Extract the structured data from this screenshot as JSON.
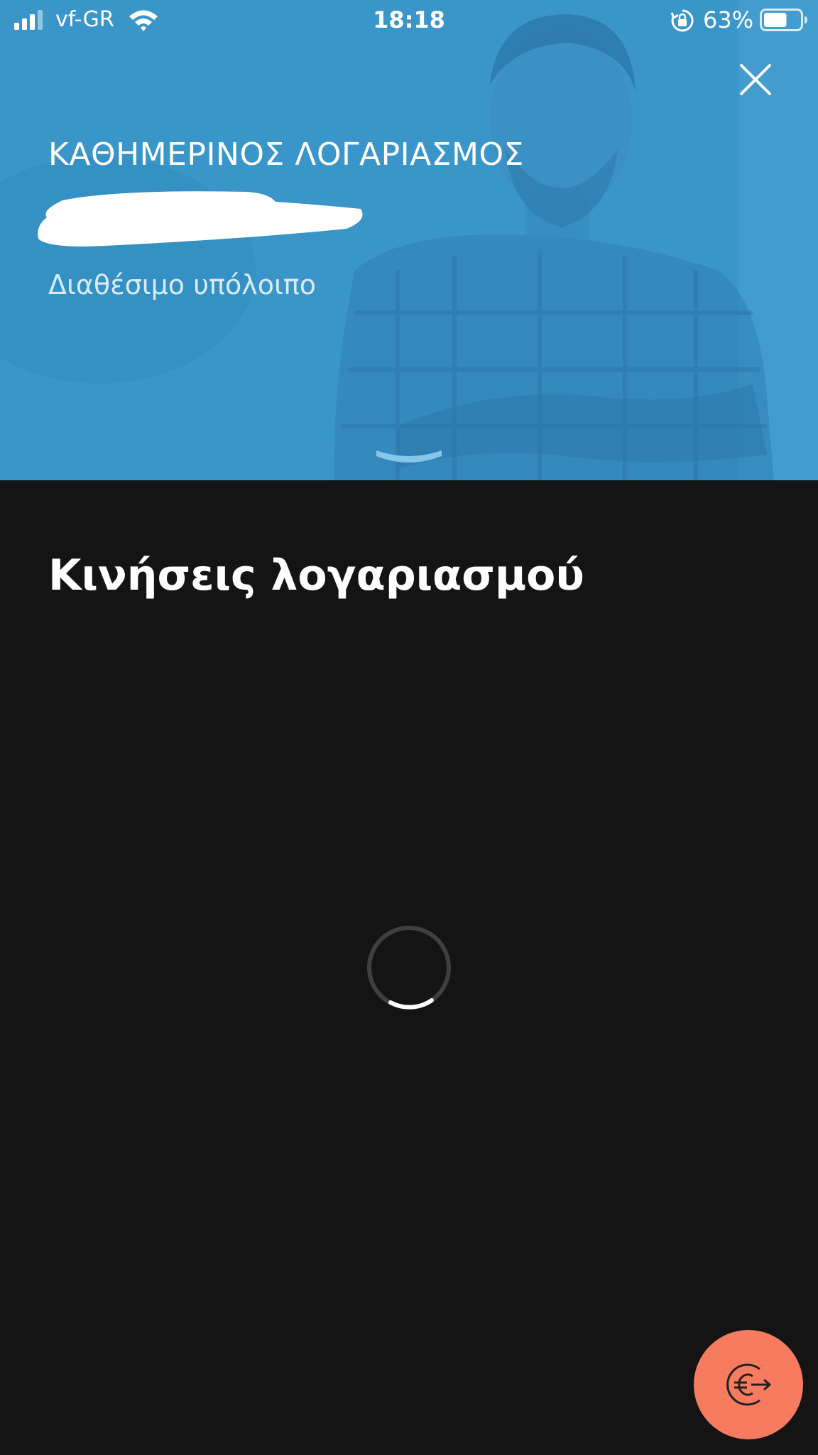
{
  "status_bar": {
    "carrier": "vf-GR",
    "time": "18:18",
    "battery_percent": "63%",
    "battery_level": 0.63,
    "icons": [
      "signal-icon",
      "wifi-icon",
      "rotation-lock-icon",
      "battery-icon"
    ]
  },
  "header": {
    "account_name": "ΚΑΘΗΜΕΡΙΝΟΣ ΛΟΓΑΡΙΑΣΜΟΣ",
    "balance_label": "Διαθέσιμο υπόλοιπο",
    "close_icon": "close-icon",
    "expand_icon": "chevron-down-icon"
  },
  "main": {
    "section_title": "Κινήσεις λογαριασμού",
    "loading_icon": "loading-spinner"
  },
  "fab": {
    "icon": "euro-transfer-icon"
  },
  "colors": {
    "header_blue": "#3b97c9",
    "background": "#141414",
    "fab": "#f77b5f",
    "text": "#ffffff"
  }
}
